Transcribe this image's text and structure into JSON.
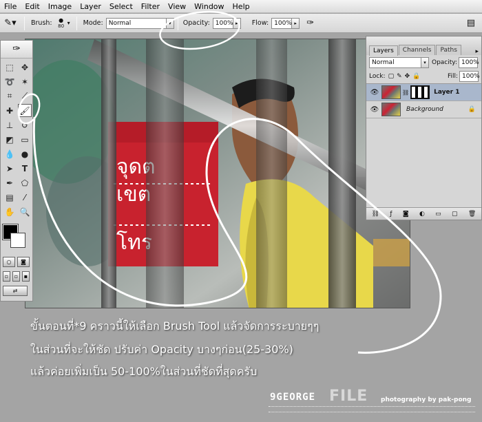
{
  "menubar": {
    "items": [
      "File",
      "Edit",
      "Image",
      "Layer",
      "Select",
      "Filter",
      "View",
      "Window",
      "Help"
    ]
  },
  "options": {
    "brush_label": "Brush:",
    "brush_size": "80",
    "mode_label": "Mode:",
    "mode_value": "Normal",
    "opacity_label": "Opacity:",
    "opacity_value": "100%",
    "flow_label": "Flow:",
    "flow_value": "100%"
  },
  "layers_panel": {
    "tabs": [
      "Layers",
      "Channels",
      "Paths"
    ],
    "blend_mode": "Normal",
    "opacity_label": "Opacity:",
    "opacity_value": "100%",
    "lock_label": "Lock:",
    "fill_label": "Fill:",
    "fill_value": "100%",
    "layers": [
      {
        "name": "Layer 1",
        "selected": true
      },
      {
        "name": "Background",
        "selected": false
      }
    ]
  },
  "photo": {
    "sign_lines": [
      "จุดต",
      "เขต",
      "โทร"
    ]
  },
  "caption": {
    "line1": "ขั้นตอนที่*9 คราวนี้ให้เลือก Brush Tool แล้วจัดการระบายๆๆ",
    "line2": "ในส่วนที่จะให้ชัด ปรับค่า Opacity บางๆก่อน(25-30%)",
    "line3": "แล้วค่อยเพิ่มเป็น 50-100%ในส่วนที่ชัดที่สุดครับ"
  },
  "credits": {
    "logo_text": "9GEORGE",
    "logo_sub": "FILE",
    "photography": "photography by pak-pong"
  },
  "colors": {
    "menubar_bg": "#e6e6e6",
    "workspace_bg": "#a4a4a4",
    "sign_red": "#c8222e",
    "shirt_yellow": "#e8d84a",
    "selected_layer": "#a9b7cc"
  }
}
